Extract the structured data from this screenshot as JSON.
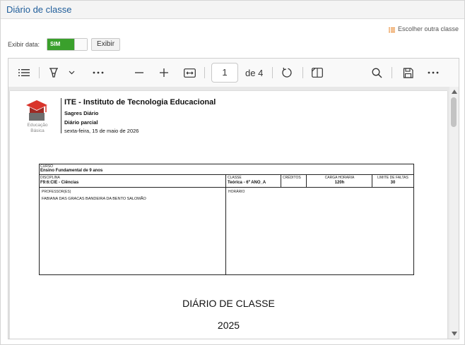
{
  "panel": {
    "title": "Diário de classe"
  },
  "actions": {
    "escolher_label": "Escolher outra classe"
  },
  "exibir": {
    "label": "Exibir data:",
    "toggle_on_label": "SIM",
    "toggle_state": true,
    "button_label": "Exibir"
  },
  "toolbar": {
    "page_current": "1",
    "page_of": "de 4",
    "icons": [
      "contents-icon",
      "draw-icon",
      "chevron-down-icon",
      "more-icon",
      "zoom-out-icon",
      "zoom-in-icon",
      "fit-width-icon",
      "rotate-icon",
      "page-view-icon",
      "search-icon",
      "save-icon",
      "more-icon"
    ]
  },
  "document": {
    "logo_text": "Educação Básica",
    "institution": "ITE - Instituto de Tecnologia Educacional",
    "subtitle1": "Sagres Diário",
    "subtitle2": "Diário parcial",
    "date": "sexta-feira, 15 de maio de 2026",
    "curso_label": "CURSO",
    "curso_value": "Ensino Fundamental de 9 anos",
    "disciplina_label": "DISCIPLINA",
    "disciplina_value": "F9:6:CIE - Ciências",
    "classe_label": "CLASSE",
    "classe_value": "Teórica - 6º ANO_A",
    "creditos_label": "CRÉDITOS",
    "carga_label": "CARGA HORARIA",
    "carga_value": "120h",
    "limite_label": "LIMITE DE FALTAS",
    "limite_value": "30",
    "professor_label": "PROFESSOR(ES)",
    "professor_value": "FABIANA DAS GRACAS BANDEIRA DA BENTO SALOMÃO",
    "horario_label": "HORÁRIO",
    "title": "DIÁRIO DE CLASSE",
    "year": "2025"
  },
  "colors": {
    "accent": "#1f5d9a",
    "toggle_on": "#3aa02c",
    "logo_red": "#d9342b"
  }
}
